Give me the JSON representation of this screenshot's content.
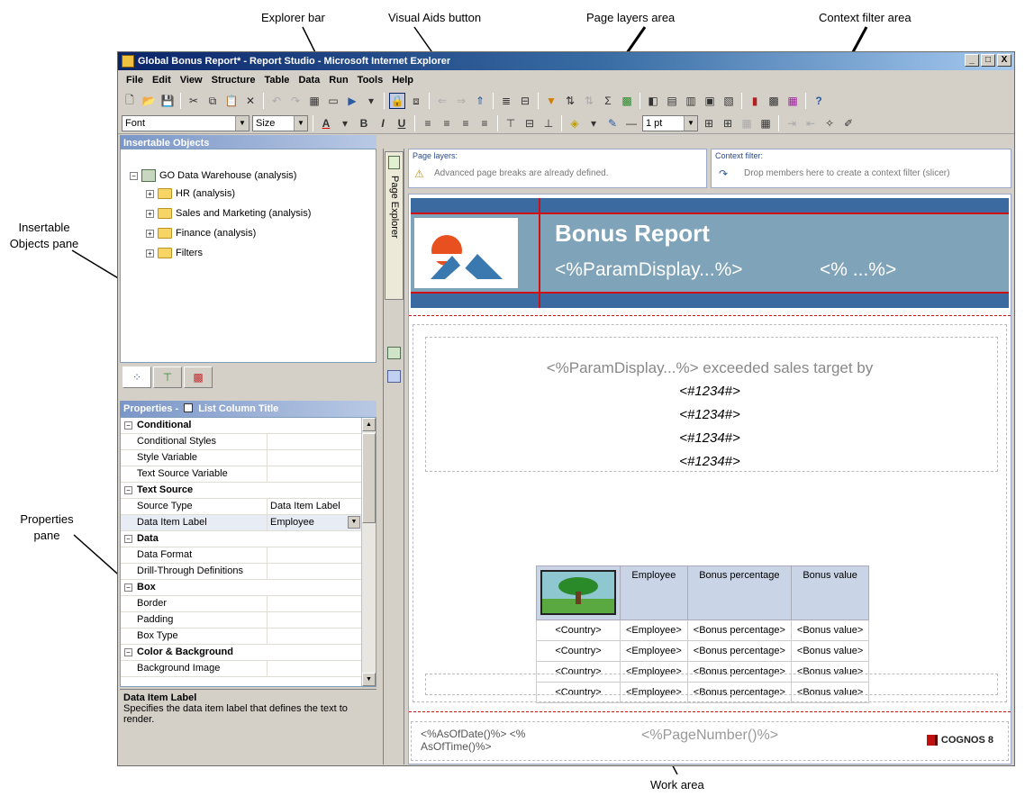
{
  "callouts": {
    "explorer_bar": "Explorer bar",
    "visual_aids_button": "Visual Aids button",
    "page_layers_area": "Page layers area",
    "context_filter_area": "Context filter area",
    "insertable_objects_pane": "Insertable Objects pane",
    "properties_pane": "Properties pane",
    "work_area": "Work area"
  },
  "window": {
    "title": "Global Bonus Report* - Report Studio - Microsoft Internet Explorer",
    "buttons": [
      "_",
      "□",
      "X"
    ]
  },
  "menu": [
    "File",
    "Edit",
    "View",
    "Structure",
    "Table",
    "Data",
    "Run",
    "Tools",
    "Help"
  ],
  "format_toolbar": {
    "font": "Font",
    "size": "Size",
    "line_width": "1 pt"
  },
  "insertable_objects": {
    "header": "Insertable Objects",
    "root": "GO Data Warehouse (analysis)",
    "children": [
      "HR (analysis)",
      "Sales and Marketing (analysis)",
      "Finance (analysis)",
      "Filters"
    ]
  },
  "properties": {
    "header": "Properties -",
    "selected_object": "List Column Title",
    "rows": [
      {
        "name": "Conditional",
        "cat": true
      },
      {
        "name": "Conditional Styles",
        "value": ""
      },
      {
        "name": "Style Variable",
        "value": ""
      },
      {
        "name": "Text Source Variable",
        "value": ""
      },
      {
        "name": "Text Source",
        "cat": true
      },
      {
        "name": "Source Type",
        "value": "Data Item Label"
      },
      {
        "name": "Data Item Label",
        "value": "Employee",
        "selected": true
      },
      {
        "name": "Data",
        "cat": true
      },
      {
        "name": "Data Format",
        "value": ""
      },
      {
        "name": "Drill-Through Definitions",
        "value": ""
      },
      {
        "name": "Box",
        "cat": true
      },
      {
        "name": "Border",
        "value": ""
      },
      {
        "name": "Padding",
        "value": ""
      },
      {
        "name": "Box Type",
        "value": ""
      },
      {
        "name": "Color & Background",
        "cat": true
      },
      {
        "name": "Background Image",
        "value": ""
      }
    ],
    "description_title": "Data Item Label",
    "description_text": "Specifies the data item label that defines the text to render."
  },
  "explorer": {
    "page_explorer": "Page Explorer"
  },
  "page_layers": {
    "title": "Page layers:",
    "message": "Advanced page breaks are already defined."
  },
  "context_filter": {
    "title": "Context filter:",
    "message": "Drop members here to create a context filter (slicer)"
  },
  "report": {
    "title": "Bonus Report",
    "param_display": "<%ParamDisplay...%>",
    "param_display2": "<% ...%>",
    "sales_text": "<%ParamDisplay...%>  exceeded sales target by",
    "numbers": [
      "<#1234#>",
      "<#1234#>",
      "<#1234#>",
      "<#1234#>"
    ],
    "columns": [
      "Employee",
      "Bonus percentage",
      "Bonus value"
    ],
    "rows": [
      [
        "<Country>",
        "<Employee>",
        "<Bonus percentage>",
        "<Bonus value>"
      ],
      [
        "<Country>",
        "<Employee>",
        "<Bonus percentage>",
        "<Bonus value>"
      ],
      [
        "<Country>",
        "<Employee>",
        "<Bonus percentage>",
        "<Bonus value>"
      ],
      [
        "<Country>",
        "<Employee>",
        "<Bonus percentage>",
        "<Bonus value>"
      ]
    ],
    "footer_left": "<%AsOfDate()%>  <% AsOfTime()%>",
    "footer_mid": "<%PageNumber()%>",
    "footer_logo": "COGNOS 8"
  }
}
